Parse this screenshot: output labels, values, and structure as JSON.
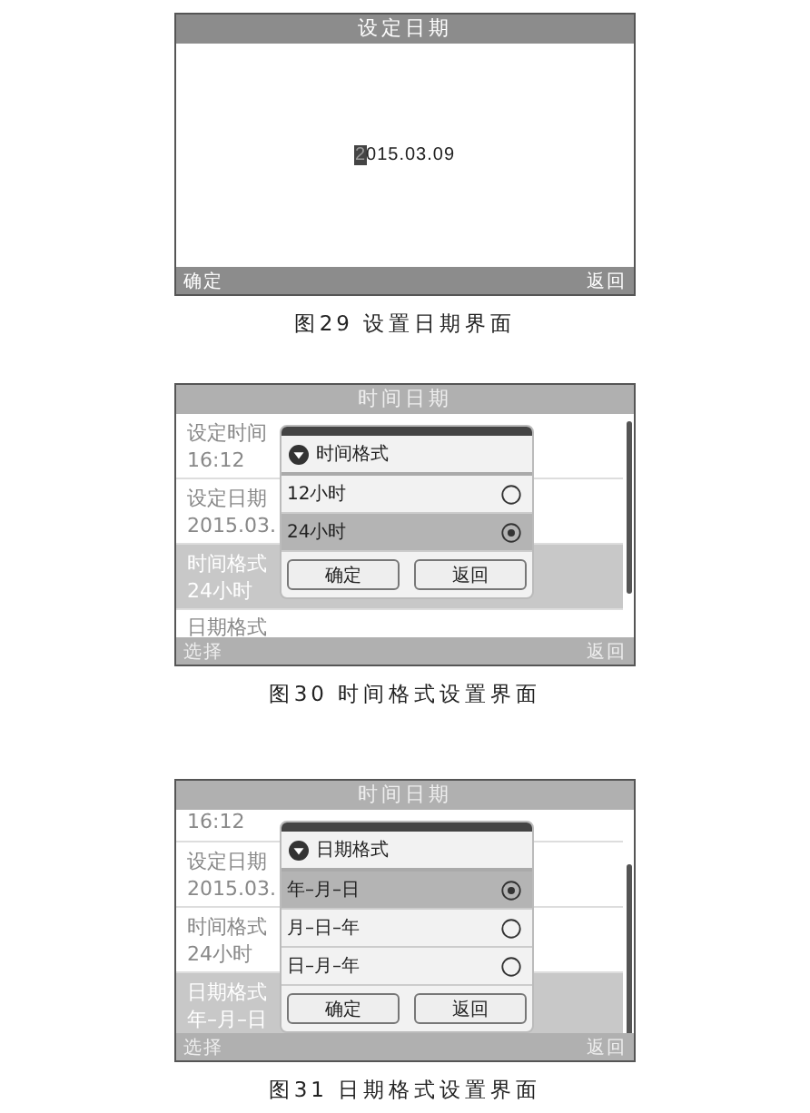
{
  "figures": [
    {
      "kind": "date_edit",
      "title": "设定日期",
      "value_parts": [
        {
          "text": "2",
          "selected": true
        },
        {
          "text": "015.03.09",
          "selected": false
        }
      ],
      "softkeys": [
        "确定",
        "返回"
      ],
      "caption": "图29 设置日期界面"
    },
    {
      "kind": "list_dialog",
      "title": "时间日期",
      "scrolled": false,
      "items": [
        {
          "label": "设定时间",
          "value": "16:12",
          "selected": false
        },
        {
          "label": "设定日期",
          "value": "2015.03.",
          "selected": false
        },
        {
          "label": "时间格式",
          "value": "24小时",
          "selected": true
        },
        {
          "label": "日期格式",
          "selected": false
        }
      ],
      "dialog": {
        "title": "时间格式",
        "options": [
          {
            "label": "12小时",
            "selected": false
          },
          {
            "label": "24小时",
            "selected": true
          }
        ],
        "buttons": [
          "确定",
          "返回"
        ]
      },
      "softkeys": [
        "选择",
        "返回"
      ],
      "caption": "图30 时间格式设置界面"
    },
    {
      "kind": "list_dialog",
      "title": "时间日期",
      "scrolled": true,
      "items": [
        {
          "value": "16:12",
          "selected": false
        },
        {
          "label": "设定日期",
          "value": "2015.03.",
          "selected": false
        },
        {
          "label": "时间格式",
          "value": "24小时",
          "selected": false
        },
        {
          "label": "日期格式",
          "value": "年–月–日",
          "selected": true
        }
      ],
      "dialog": {
        "title": "日期格式",
        "options": [
          {
            "label": "年–月–日",
            "selected": true
          },
          {
            "label": "月–日–年",
            "selected": false
          },
          {
            "label": "日–月–年",
            "selected": false
          }
        ],
        "buttons": [
          "确定",
          "返回"
        ]
      },
      "softkeys": [
        "选择",
        "返回"
      ],
      "caption": "图31 日期格式设置界面"
    }
  ]
}
